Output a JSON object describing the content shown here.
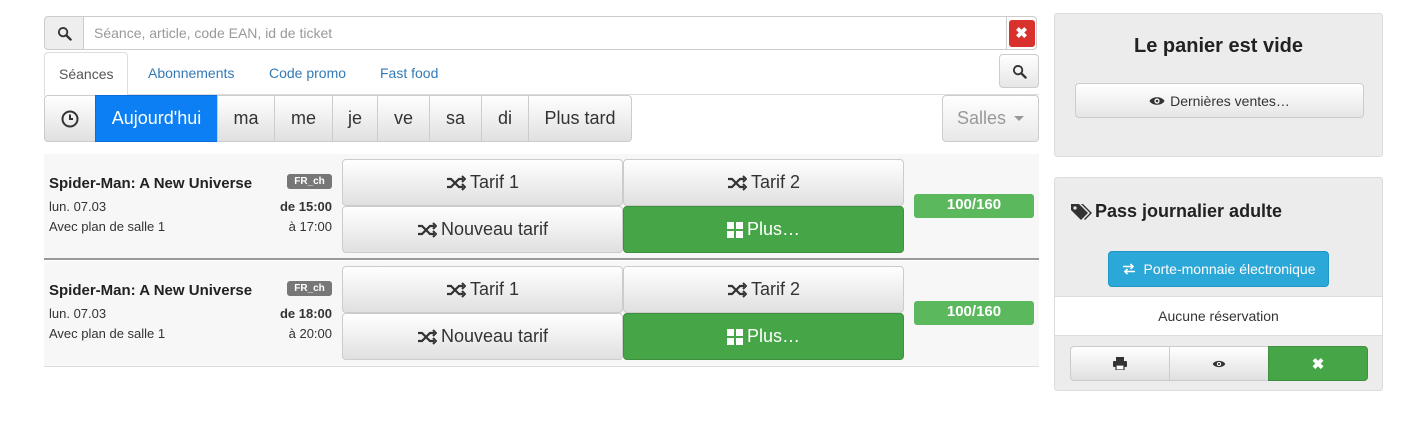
{
  "search": {
    "placeholder": "Séance, article, code EAN, id de ticket",
    "clear_label": "✖"
  },
  "tabs": [
    {
      "label": "Séances"
    },
    {
      "label": "Abonnements"
    },
    {
      "label": "Code promo"
    },
    {
      "label": "Fast food"
    }
  ],
  "days": [
    {
      "label": "Aujourd'hui"
    },
    {
      "label": "ma"
    },
    {
      "label": "me"
    },
    {
      "label": "je"
    },
    {
      "label": "ve"
    },
    {
      "label": "sa"
    },
    {
      "label": "di"
    },
    {
      "label": "Plus tard"
    }
  ],
  "salles_label": "Salles",
  "screenings": [
    {
      "title": "Spider-Man: A New Universe",
      "lang": "FR_ch",
      "date": "lun. 07.03",
      "start": "de 15:00",
      "plan": "Avec plan de salle 1",
      "end": "à 17:00",
      "tarif1": "Tarif 1",
      "tarif2": "Tarif 2",
      "nouveau": "Nouveau tarif",
      "plus": "Plus…",
      "capacity": "100/160"
    },
    {
      "title": "Spider-Man: A New Universe",
      "lang": "FR_ch",
      "date": "lun. 07.03",
      "start": "de 18:00",
      "plan": "Avec plan de salle 1",
      "end": "à 20:00",
      "tarif1": "Tarif 1",
      "tarif2": "Tarif 2",
      "nouveau": "Nouveau tarif",
      "plus": "Plus…",
      "capacity": "100/160"
    }
  ],
  "cart": {
    "title": "Le panier est vide",
    "last_sales": "Dernières ventes…"
  },
  "pass": {
    "title": "Pass journalier adulte",
    "wallet": "Porte-monnaie électronique",
    "no_reservation": "Aucune réservation",
    "delete_label": "✖"
  },
  "colors": {
    "primary": "#0b7ff3",
    "success": "#46a546",
    "capacity": "#5cb85c",
    "danger": "#d9312c",
    "info": "#2ca8d8"
  }
}
